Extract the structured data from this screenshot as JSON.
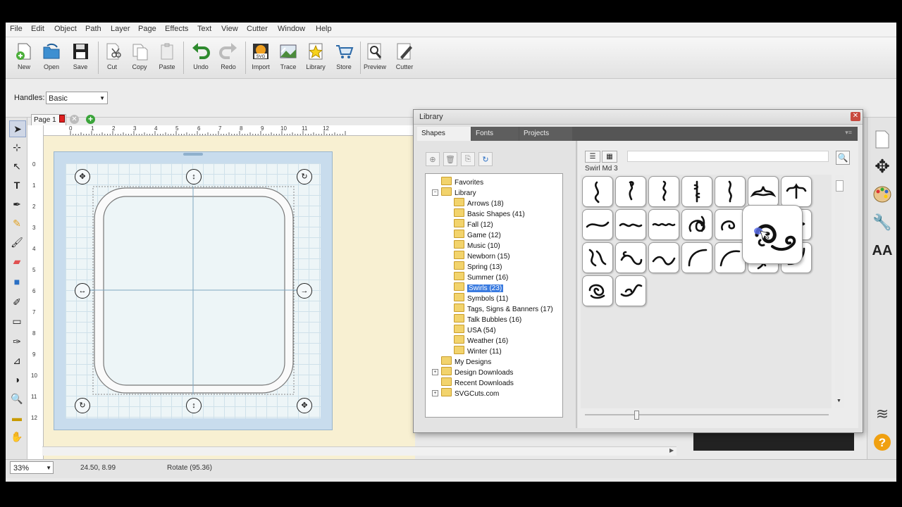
{
  "menu": [
    "File",
    "Edit",
    "Object",
    "Path",
    "Layer",
    "Page",
    "Effects",
    "Text",
    "View",
    "Cutter",
    "Window",
    "Help"
  ],
  "toolbar": {
    "new": "New",
    "open": "Open",
    "save": "Save",
    "cut": "Cut",
    "copy": "Copy",
    "paste": "Paste",
    "undo": "Undo",
    "redo": "Redo",
    "import": "Import",
    "trace": "Trace",
    "library": "Library",
    "store": "Store",
    "preview": "Preview",
    "cutter": "Cutter"
  },
  "properties": {
    "handles_label": "Handles:",
    "handles_value": "Basic"
  },
  "page_tab": {
    "label": "Page 1"
  },
  "ruler": {
    "top": [
      "0",
      "1",
      "2",
      "3",
      "4",
      "5",
      "6",
      "7",
      "8",
      "9",
      "10",
      "11",
      "12"
    ],
    "left": [
      "0",
      "1",
      "2",
      "3",
      "4",
      "5",
      "6",
      "7",
      "8",
      "9",
      "10",
      "11",
      "12"
    ]
  },
  "status": {
    "zoom": "33%",
    "coords": "24.50, 8.99",
    "message": "Rotate (95.36)"
  },
  "library": {
    "title": "Library",
    "tabs": [
      "Shapes",
      "Fonts",
      "Projects"
    ],
    "selected_shape": "Swirl Md 3",
    "tree": [
      {
        "label": "Favorites",
        "level": 1
      },
      {
        "label": "Library",
        "level": 1,
        "expanded": true
      },
      {
        "label": "Arrows (18)",
        "level": 2
      },
      {
        "label": "Basic Shapes (41)",
        "level": 2
      },
      {
        "label": "Fall (12)",
        "level": 2
      },
      {
        "label": "Game (12)",
        "level": 2
      },
      {
        "label": "Music (10)",
        "level": 2
      },
      {
        "label": "Newborn (15)",
        "level": 2
      },
      {
        "label": "Spring (13)",
        "level": 2
      },
      {
        "label": "Summer (16)",
        "level": 2
      },
      {
        "label": "Swirls (23)",
        "level": 2,
        "selected": true
      },
      {
        "label": "Symbols (11)",
        "level": 2
      },
      {
        "label": "Tags, Signs & Banners (17)",
        "level": 2
      },
      {
        "label": "Talk Bubbles (16)",
        "level": 2
      },
      {
        "label": "USA (54)",
        "level": 2
      },
      {
        "label": "Weather (16)",
        "level": 2
      },
      {
        "label": "Winter (11)",
        "level": 2
      },
      {
        "label": "My Designs",
        "level": 1
      },
      {
        "label": "Design Downloads",
        "level": 1,
        "collapsed": true
      },
      {
        "label": "Recent Downloads",
        "level": 1
      },
      {
        "label": "SVGCuts.com",
        "level": 1,
        "collapsed": true
      }
    ],
    "thumbnail_count": 23
  }
}
